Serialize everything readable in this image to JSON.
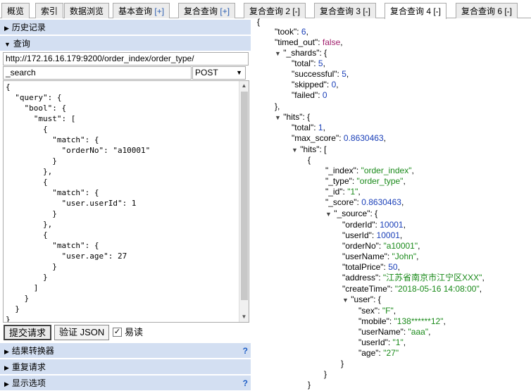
{
  "tabs": [
    {
      "label": "概览"
    },
    {
      "label": "索引"
    },
    {
      "label": "数据浏览"
    },
    {
      "label": "基本查询",
      "suffix": "[+]"
    },
    {
      "label": "复合查询",
      "suffix": "[+]"
    },
    {
      "label": "复合查询 2 [-]"
    },
    {
      "label": "复合查询 3 [-]"
    },
    {
      "label": "复合查询 4 [-]"
    },
    {
      "label": "复合查询 6 [-]"
    }
  ],
  "left": {
    "history_label": "历史记录",
    "query_label": "查询",
    "url": "http://172.16.16.179:9200/order_index/order_type/",
    "path": "_search",
    "method": "POST",
    "body": "{\n  \"query\": {\n    \"bool\": {\n      \"must\": [\n        {\n          \"match\": {\n            \"orderNo\": \"a10001\"\n          }\n        },\n        {\n          \"match\": {\n            \"user.userId\": 1\n          }\n        },\n        {\n          \"match\": {\n            \"user.age\": 27\n          }\n        }\n      ]\n    }\n  }\n}",
    "submit_label": "提交请求",
    "validate_label": "验证 JSON",
    "easy_label": "易读",
    "result_transformer_label": "结果转换器",
    "repeat_request_label": "重复请求",
    "display_options_label": "显示选项",
    "help": "?"
  },
  "response": {
    "took_key": "\"took\"",
    "took": "6",
    "timed_out_key": "\"timed_out\"",
    "timed_out": "false",
    "shards_key": "\"_shards\"",
    "shards": [
      {
        "k": "\"total\"",
        "v": "5"
      },
      {
        "k": "\"successful\"",
        "v": "5"
      },
      {
        "k": "\"skipped\"",
        "v": "0"
      },
      {
        "k": "\"failed\"",
        "v": "0"
      }
    ],
    "hits_key": "\"hits\"",
    "hits_total_key": "\"total\"",
    "hits_total": "1",
    "max_score_key": "\"max_score\"",
    "max_score": "0.8630463",
    "hits_inner_key": "\"hits\"",
    "doc": [
      {
        "k": "\"_index\"",
        "v": "\"order_index\""
      },
      {
        "k": "\"_type\"",
        "v": "\"order_type\""
      },
      {
        "k": "\"_id\"",
        "v": "\"1\""
      },
      {
        "k": "\"_score\"",
        "v": "0.8630463"
      }
    ],
    "source_key": "\"_source\"",
    "source": [
      {
        "k": "\"orderId\"",
        "v": "10001",
        "t": "n"
      },
      {
        "k": "\"userId\"",
        "v": "10001",
        "t": "n"
      },
      {
        "k": "\"orderNo\"",
        "v": "\"a10001\"",
        "t": "s"
      },
      {
        "k": "\"userName\"",
        "v": "\"John\"",
        "t": "s"
      },
      {
        "k": "\"totalPrice\"",
        "v": "50",
        "t": "n"
      },
      {
        "k": "\"address\"",
        "v": "\"江苏省南京市江宁区XXX\"",
        "t": "s"
      },
      {
        "k": "\"createTime\"",
        "v": "\"2018-05-16 14:08:00\"",
        "t": "s"
      }
    ],
    "user_key": "\"user\"",
    "user": [
      {
        "k": "\"sex\"",
        "v": "\"F\""
      },
      {
        "k": "\"mobile\"",
        "v": "\"138******12\""
      },
      {
        "k": "\"userName\"",
        "v": "\"aaa\""
      },
      {
        "k": "\"userId\"",
        "v": "\"1\""
      },
      {
        "k": "\"age\"",
        "v": "\"27\""
      }
    ]
  }
}
